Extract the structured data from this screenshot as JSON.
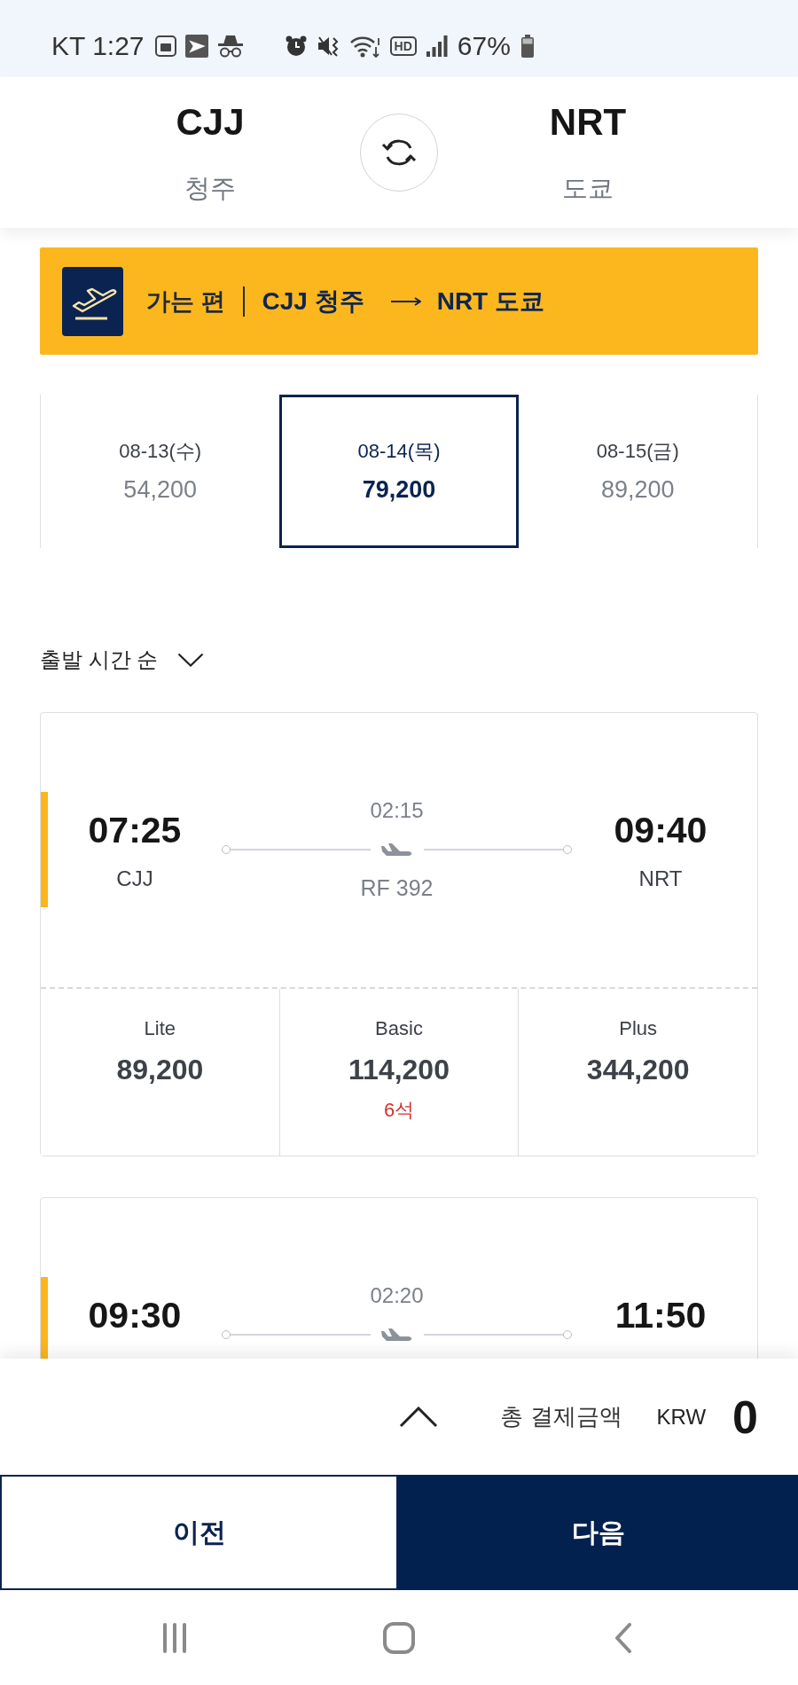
{
  "status_bar": {
    "carrier_time": "KT 1:27",
    "hd_badge": "HD",
    "battery_text": "67%"
  },
  "route_header": {
    "origin": {
      "code": "CJJ",
      "city": "청주"
    },
    "destination": {
      "code": "NRT",
      "city": "도쿄"
    }
  },
  "leg_banner": {
    "label": "가는 편",
    "origin": "CJJ 청주",
    "destination": "NRT 도쿄"
  },
  "date_tabs": [
    {
      "date": "08-13(수)",
      "price": "54,200",
      "selected": false
    },
    {
      "date": "08-14(목)",
      "price": "79,200",
      "selected": true
    },
    {
      "date": "08-15(금)",
      "price": "89,200",
      "selected": false
    }
  ],
  "sort": {
    "label": "출발 시간 순"
  },
  "flights": [
    {
      "departure_time": "07:25",
      "departure_airport": "CJJ",
      "duration": "02:15",
      "flight_number": "RF 392",
      "arrival_time": "09:40",
      "arrival_airport": "NRT",
      "fares": [
        {
          "class": "Lite",
          "price": "89,200"
        },
        {
          "class": "Basic",
          "price": "114,200",
          "seats": "6석"
        },
        {
          "class": "Plus",
          "price": "344,200"
        }
      ]
    },
    {
      "departure_time": "09:30",
      "duration": "02:20",
      "arrival_time": "11:50"
    }
  ],
  "summary": {
    "label": "총 결제금액",
    "currency": "KRW",
    "amount": "0"
  },
  "buttons": [
    {
      "label": "이전",
      "kind": "secondary"
    },
    {
      "label": "다음",
      "kind": "primary"
    }
  ]
}
